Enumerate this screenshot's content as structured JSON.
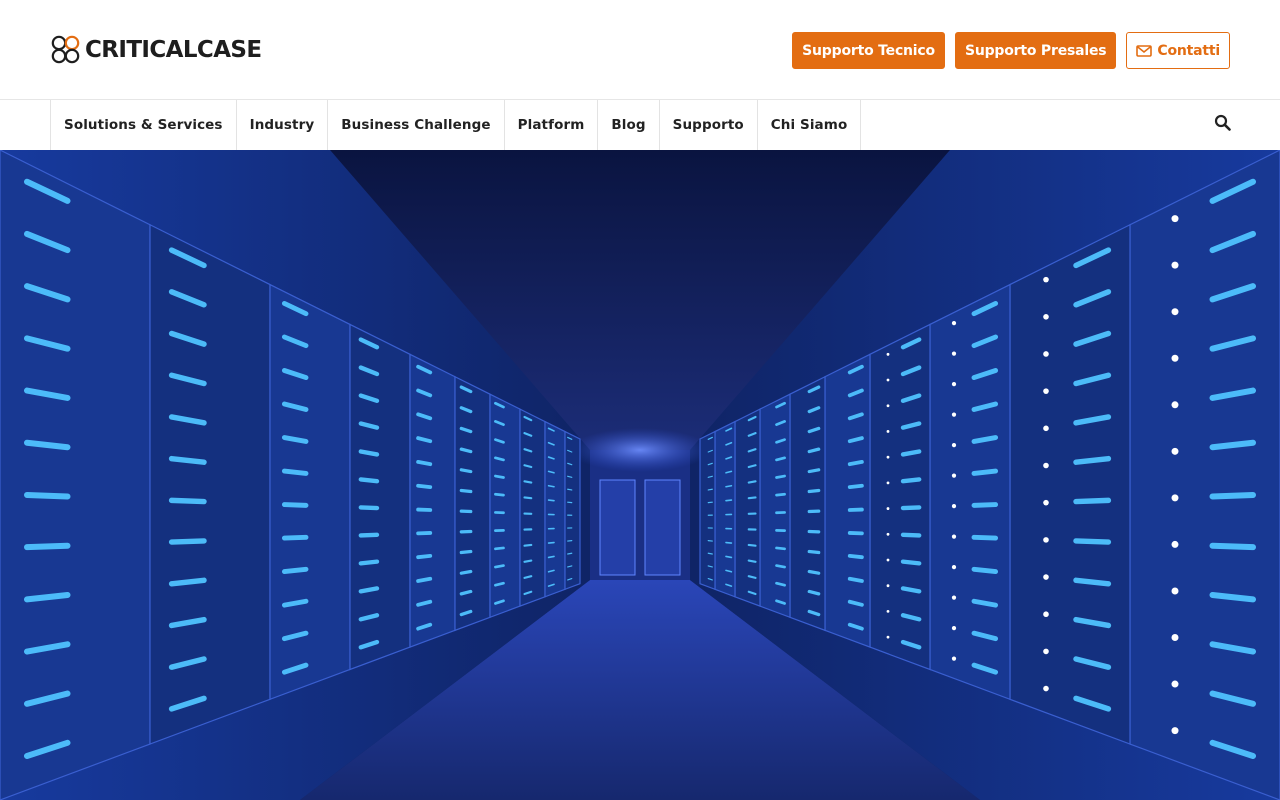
{
  "brand": {
    "logo_text": "CRITICALCASE",
    "accent_color": "#e36d12"
  },
  "header": {
    "buttons": [
      {
        "label": "Supporto Tecnico"
      },
      {
        "label": "Supporto Presales"
      },
      {
        "label": "Contatti",
        "icon": "mail-icon"
      }
    ]
  },
  "nav": {
    "items": [
      {
        "label": "Solutions & Services"
      },
      {
        "label": "Industry"
      },
      {
        "label": "Business Challenge"
      },
      {
        "label": "Platform"
      },
      {
        "label": "Blog"
      },
      {
        "label": "Supporto"
      },
      {
        "label": "Chi Siamo"
      }
    ],
    "search_icon": "search-icon"
  },
  "hero": {
    "image": "data-center-server-corridor"
  }
}
